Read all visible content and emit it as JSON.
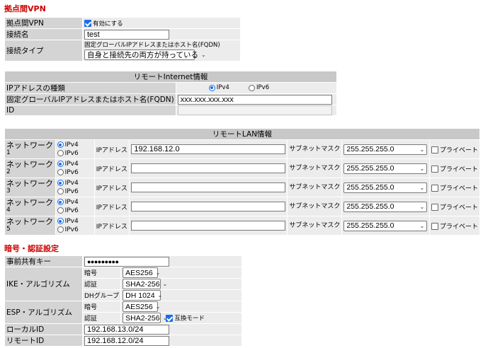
{
  "vpn_section": {
    "title": "拠点間VPN",
    "enable_label": "拠点間VPN",
    "enable_checkbox_label": "有効にする",
    "enable_checked": true,
    "conn_name_label": "接続名",
    "conn_name_value": "test",
    "conn_type_label": "接続タイプ",
    "conn_type_note": "固定グローバルIPアドレスまたはホスト名(FQDN)",
    "conn_type_value": "自身と接続先の両方が持っている"
  },
  "internet_section": {
    "header": "リモートInternet情報",
    "ip_type_label": "IPアドレスの種類",
    "ipv4_label": "IPv4",
    "ipv6_label": "IPv6",
    "ip_type_selected": "IPv4",
    "fqdn_label": "固定グローバルIPアドレスまたはホスト名(FQDN)",
    "fqdn_value": "xxx.xxx.xxx.xxx",
    "id_label": "ID",
    "id_value": ""
  },
  "lan_section": {
    "header": "リモートLAN情報",
    "ipv4_label": "IPv4",
    "ipv6_label": "IPv6",
    "ip_label": "IPアドレス",
    "mask_label": "サブネットマスク",
    "private_label": "プライベート",
    "networks": [
      {
        "name": "ネットワーク",
        "num": "1",
        "proto": "IPv4",
        "ip": "192.168.12.0",
        "mask": "255.255.255.0",
        "private": false
      },
      {
        "name": "ネットワーク",
        "num": "2",
        "proto": "IPv4",
        "ip": "",
        "mask": "255.255.255.0",
        "private": false
      },
      {
        "name": "ネットワーク",
        "num": "3",
        "proto": "IPv4",
        "ip": "",
        "mask": "255.255.255.0",
        "private": false
      },
      {
        "name": "ネットワーク",
        "num": "4",
        "proto": "IPv4",
        "ip": "",
        "mask": "255.255.255.0",
        "private": false
      },
      {
        "name": "ネットワーク",
        "num": "5",
        "proto": "IPv4",
        "ip": "",
        "mask": "255.255.255.0",
        "private": false
      }
    ]
  },
  "auth_section": {
    "title": "暗号・認証設定",
    "psk_label": "事前共有キー",
    "psk_value": "●●●●●●●●●",
    "ike_label": "IKE・アルゴリズム",
    "ike_enc_label": "暗号",
    "ike_enc_value": "AES256",
    "ike_auth_label": "認証",
    "ike_auth_value": "SHA2-256",
    "ike_dh_label": "DHグループ",
    "ike_dh_value": "DH 1024",
    "esp_label": "ESP・アルゴリズム",
    "esp_enc_label": "暗号",
    "esp_enc_value": "AES256",
    "esp_auth_label": "認証",
    "esp_auth_value": "SHA2-256",
    "compat_label": "互換モード",
    "compat_checked": true,
    "local_id_label": "ローカルID",
    "local_id_value": "192.168.13.0/24",
    "remote_id_label": "リモートID",
    "remote_id_value": "192.168.12.0/24"
  }
}
